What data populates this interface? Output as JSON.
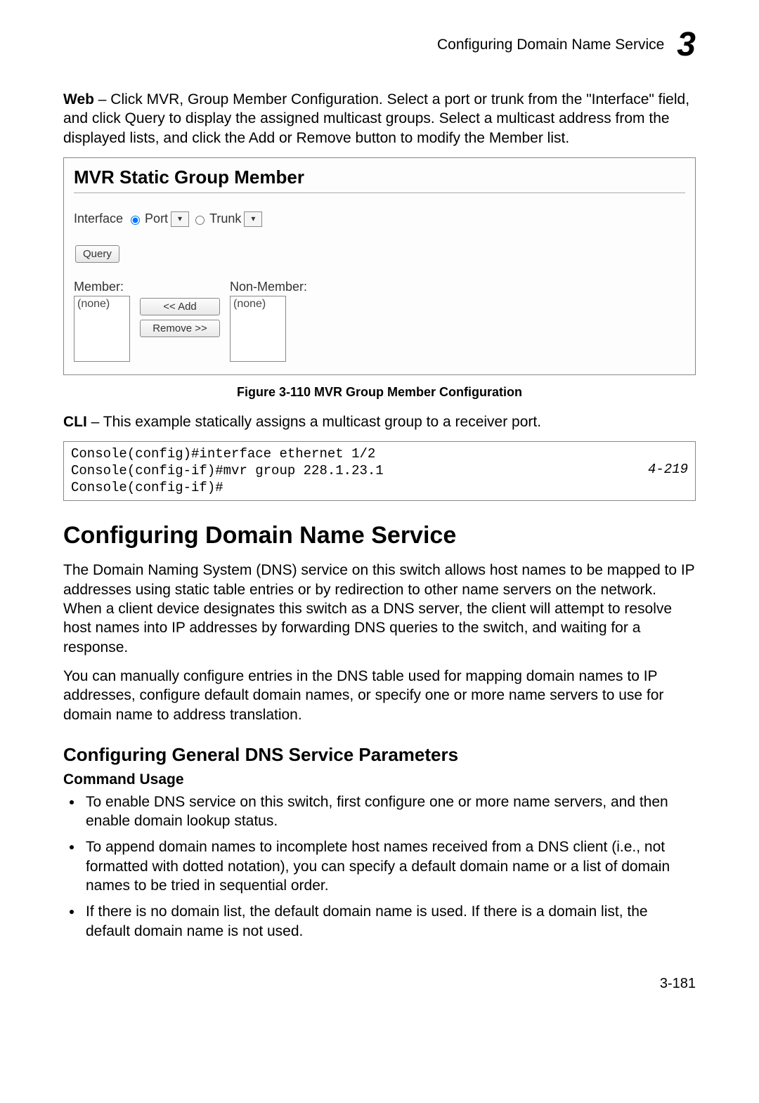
{
  "header": {
    "title": "Configuring Domain Name Service",
    "chapter": "3"
  },
  "web_para_prefix": "Web",
  "web_para": " – Click MVR, Group Member Configuration. Select a port or trunk from the \"Interface\" field, and click Query to display the assigned multicast groups. Select a multicast address from the displayed lists, and click the Add or Remove button to modify the Member list.",
  "figure": {
    "panel_title": "MVR Static Group Member",
    "interface_label": "Interface",
    "port_label": "Port",
    "trunk_label": "Trunk",
    "query_btn": "Query",
    "member_label": "Member:",
    "nonmember_label": "Non-Member:",
    "member_value": "(none)",
    "nonmember_value": "(none)",
    "add_btn": "<< Add",
    "remove_btn": "Remove >>",
    "caption": "Figure 3-110  MVR Group Member Configuration"
  },
  "cli_para_prefix": "CLI",
  "cli_para": " – This example statically assigns a multicast group to a receiver port.",
  "cli": {
    "line1": "Console(config)#interface ethernet 1/2",
    "line2": "Console(config-if)#mvr group 228.1.23.1",
    "line3": "Console(config-if)#",
    "ref": "4-219"
  },
  "section": {
    "h1": "Configuring Domain Name Service",
    "p1": "The Domain Naming System (DNS) service on this switch allows host names to be mapped to IP addresses using static table entries or by redirection to other name servers on the network. When a client device designates this switch as a DNS server, the client will attempt to resolve host names into IP addresses by forwarding DNS queries to the switch, and waiting for a response.",
    "p2": "You can manually configure entries in the DNS table used for mapping domain names to IP addresses, configure default domain names, or specify one or more name servers to use for domain name to address translation.",
    "h2": "Configuring General DNS Service Parameters",
    "h3": "Command Usage",
    "bullets": [
      "To enable DNS service on this switch, first configure one or more name servers, and then enable domain lookup status.",
      "To append domain names to incomplete host names received from a DNS client (i.e., not formatted with dotted notation), you can specify a default domain name or a list of domain names to be tried in sequential order.",
      "If there is no domain list, the default domain name is used. If there is a domain list, the default domain name is not used."
    ]
  },
  "page_number": "3-181"
}
